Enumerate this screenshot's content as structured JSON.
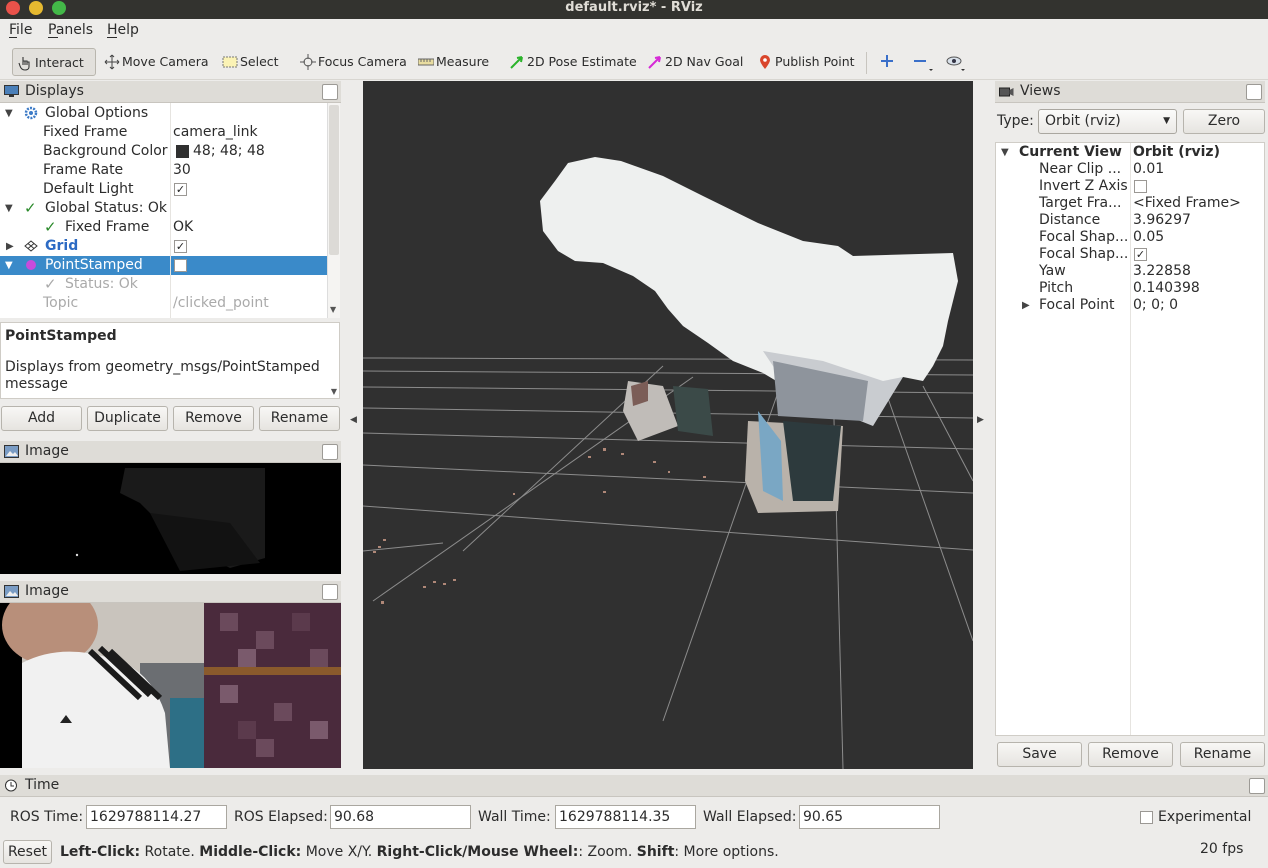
{
  "window": {
    "title": "default.rviz* - RViz"
  },
  "menu": {
    "file": "File",
    "panels": "Panels",
    "help": "Help"
  },
  "toolbar": {
    "interact": "Interact",
    "move_camera": "Move Camera",
    "select": "Select",
    "focus_camera": "Focus Camera",
    "measure": "Measure",
    "pose_estimate": "2D Pose Estimate",
    "nav_goal": "2D Nav Goal",
    "publish_point": "Publish Point"
  },
  "displays": {
    "title": "Displays",
    "rows": [
      {
        "key": "Global Options",
        "value": ""
      },
      {
        "key": "Fixed Frame",
        "value": "camera_link"
      },
      {
        "key": "Background Color",
        "value": "48; 48; 48"
      },
      {
        "key": "Frame Rate",
        "value": "30"
      },
      {
        "key": "Default Light",
        "value": ""
      },
      {
        "key": "Global Status: Ok",
        "value": ""
      },
      {
        "key": "Fixed Frame",
        "value": "OK"
      },
      {
        "key": "Grid",
        "value": ""
      },
      {
        "key": "PointStamped",
        "value": ""
      },
      {
        "key": "Status: Ok",
        "value": ""
      },
      {
        "key": "Topic",
        "value": "/clicked_point"
      }
    ],
    "background_color_hex": "#303030",
    "description_title": "PointStamped",
    "description_text": "Displays from geometry_msgs/PointStamped message",
    "buttons": {
      "add": "Add",
      "duplicate": "Duplicate",
      "remove": "Remove",
      "rename": "Rename"
    }
  },
  "image_panels": {
    "title1": "Image",
    "title2": "Image"
  },
  "views": {
    "title": "Views",
    "type_label": "Type:",
    "type_value": "Orbit (rviz)",
    "zero": "Zero",
    "rows": [
      {
        "key": "Current View",
        "value": "Orbit (rviz)"
      },
      {
        "key": "Near Clip ...",
        "value": "0.01"
      },
      {
        "key": "Invert Z Axis",
        "value": ""
      },
      {
        "key": "Target Fra...",
        "value": "<Fixed Frame>"
      },
      {
        "key": "Distance",
        "value": "3.96297"
      },
      {
        "key": "Focal Shap...",
        "value": "0.05"
      },
      {
        "key": "Focal Shap...",
        "value": ""
      },
      {
        "key": "Yaw",
        "value": "3.22858"
      },
      {
        "key": "Pitch",
        "value": "0.140398"
      },
      {
        "key": "Focal Point",
        "value": "0; 0; 0"
      }
    ],
    "buttons": {
      "save": "Save",
      "remove": "Remove",
      "rename": "Rename"
    }
  },
  "time": {
    "title": "Time",
    "ros_time_label": "ROS Time:",
    "ros_time": "1629788114.27",
    "ros_elapsed_label": "ROS Elapsed:",
    "ros_elapsed": "90.68",
    "wall_time_label": "Wall Time:",
    "wall_time": "1629788114.35",
    "wall_elapsed_label": "Wall Elapsed:",
    "wall_elapsed": "90.65",
    "experimental": "Experimental"
  },
  "status": {
    "reset": "Reset",
    "hint_lc": "Left-Click:",
    "hint_lc_t": " Rotate. ",
    "hint_mc": "Middle-Click:",
    "hint_mc_t": " Move X/Y. ",
    "hint_rc": "Right-Click/Mouse Wheel:",
    "hint_rc_t": ": Zoom. ",
    "hint_sh": "Shift",
    "hint_sh_t": ": More options.",
    "fps": "20 fps"
  }
}
